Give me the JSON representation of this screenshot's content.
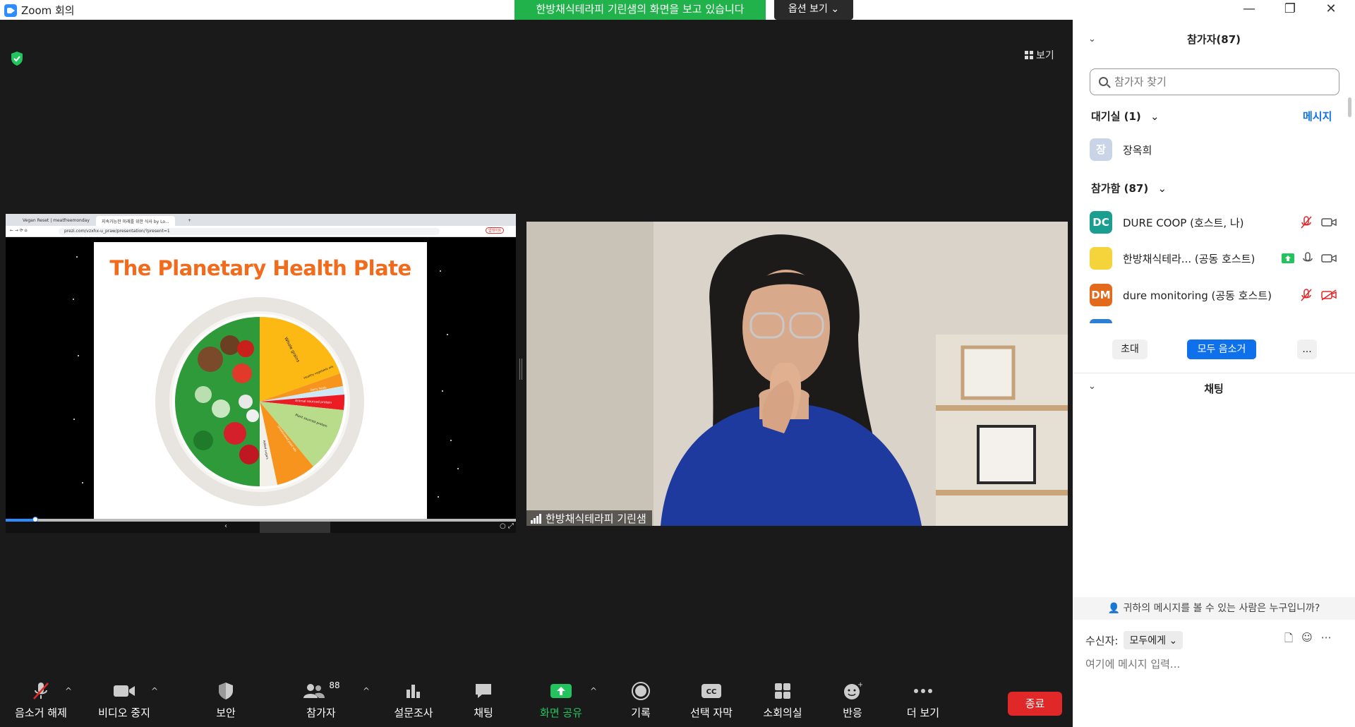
{
  "window": {
    "title": "Zoom 회의",
    "share_banner": "한방채식테라피 기린샘의 화면을 보고 있습니다",
    "view_options": "옵션 보기",
    "controls": [
      "—",
      "❐",
      "✕"
    ]
  },
  "stage": {
    "view_label": "보기",
    "shared_screen": {
      "browser_tabs": [
        "Vegan Reset | meatfreemonday",
        "지속가능한 미래를 위한 식사 by Lo..."
      ],
      "url": "prezi.com/vzxhx-u_praw/presentation/?present=1",
      "update_badge": "업데이트",
      "slide_title": "The Planetary Health Plate",
      "plate_labels": [
        "Whole grains",
        "Healthy vegetable oils",
        "Dairy foods",
        "Animal sourced protein",
        "Plant sourced protein",
        "Unsaturated plant oils",
        "Added sugars"
      ]
    },
    "video": {
      "name": "한방채식테라피 기린샘"
    }
  },
  "toolbar": {
    "items": [
      {
        "label": "음소거 해제",
        "icon": "muted-microphone-icon"
      },
      {
        "label": "비디오 중지",
        "icon": "video-camera-icon"
      },
      {
        "label": "보안",
        "icon": "shield-icon"
      },
      {
        "label": "참가자",
        "icon": "participants-icon",
        "count": "88"
      },
      {
        "label": "설문조사",
        "icon": "poll-bar-icon"
      },
      {
        "label": "채팅",
        "icon": "chat-bubble-icon"
      },
      {
        "label": "화면 공유",
        "icon": "share-screen-icon"
      },
      {
        "label": "기록",
        "icon": "record-icon"
      },
      {
        "label": "선택 자막",
        "icon": "closed-caption-icon"
      },
      {
        "label": "소회의실",
        "icon": "breakout-rooms-icon"
      },
      {
        "label": "반응",
        "icon": "reaction-icon"
      },
      {
        "label": "더 보기",
        "icon": "more-icon"
      }
    ],
    "end_label": "종료"
  },
  "panel": {
    "title": "참가자(87)",
    "search_placeholder": "참가자 찾기",
    "waiting_room": {
      "label": "대기실 (1)",
      "message_link": "메시지",
      "people": [
        {
          "initial": "장",
          "name": "장옥희"
        }
      ]
    },
    "in_meeting": {
      "label": "참가함 (87)",
      "people": [
        {
          "initials": "DC",
          "name": "DURE COOP (호스트, 나)",
          "color": "#1a9e8f",
          "mic": "muted",
          "video": "on"
        },
        {
          "initials": "",
          "name": "한방채식테라...  (공동 호스트)",
          "color": "#f5d33a",
          "mic": "on",
          "video": "on",
          "sharing": true
        },
        {
          "initials": "DM",
          "name": "dure monitoring (공동 호스트)",
          "color": "#e36a1c",
          "mic": "muted",
          "video": "off"
        }
      ]
    },
    "buttons": {
      "invite": "초대",
      "mute_all": "모두 음소거",
      "more": "..."
    },
    "chat": {
      "title": "채팅",
      "who_can_see": "귀하의 메시지를 볼 수 있는 사람은 누구입니까?",
      "to_label": "수신자:",
      "to_value": "모두에게",
      "input_placeholder": "여기에 메시지 입력..."
    }
  },
  "colors": {
    "accent": "#0e71eb",
    "share_green": "#22b24c",
    "end_red": "#e02828",
    "slide_orange": "#f26b1d"
  }
}
